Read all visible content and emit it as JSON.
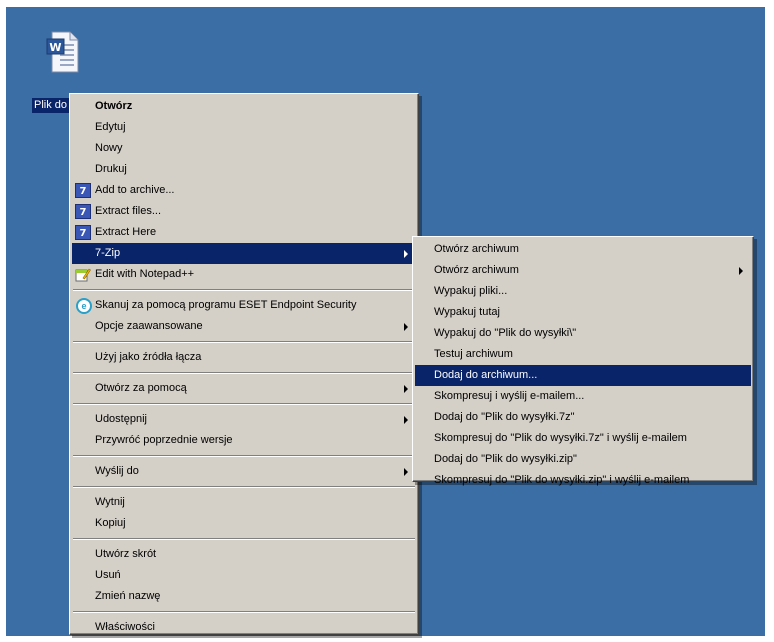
{
  "desktop": {
    "file_label": "Plik do wysyłki",
    "colors": {
      "background": "#3a6ea5",
      "selection": "#0a246a",
      "menu": "#d4d0c8"
    }
  },
  "context_menu": {
    "items": [
      {
        "label": "Otwórz"
      },
      {
        "label": "Edytuj"
      },
      {
        "label": "Nowy"
      },
      {
        "label": "Drukuj"
      },
      {
        "label": "Add to archive...",
        "icon": "7zip-icon"
      },
      {
        "label": "Extract files...",
        "icon": "7zip-icon"
      },
      {
        "label": "Extract Here",
        "icon": "7zip-icon"
      },
      {
        "label": "7-Zip"
      },
      {
        "label": "Edit with Notepad++",
        "icon": "notepad-plus-plus-icon"
      },
      {
        "label": "Skanuj za pomocą programu ESET Endpoint Security",
        "icon": "eset-icon"
      },
      {
        "label": "Opcje zaawansowane"
      },
      {
        "label": "Użyj jako źródła łącza"
      },
      {
        "label": "Otwórz za pomocą"
      },
      {
        "label": "Udostępnij"
      },
      {
        "label": "Przywróć poprzednie wersje"
      },
      {
        "label": "Wyślij do"
      },
      {
        "label": "Wytnij"
      },
      {
        "label": "Kopiuj"
      },
      {
        "label": "Utwórz skrót"
      },
      {
        "label": "Usuń"
      },
      {
        "label": "Zmień nazwę"
      },
      {
        "label": "Właściwości"
      }
    ]
  },
  "submenu_7zip": {
    "items": [
      {
        "label": "Otwórz archiwum"
      },
      {
        "label": "Otwórz archiwum"
      },
      {
        "label": "Wypakuj pliki..."
      },
      {
        "label": "Wypakuj tutaj"
      },
      {
        "label": "Wypakuj do \"Plik do wysyłki\\\""
      },
      {
        "label": "Testuj archiwum"
      },
      {
        "label": "Dodaj do archiwum..."
      },
      {
        "label": "Skompresuj i wyślij e-mailem..."
      },
      {
        "label": "Dodaj do \"Plik do wysyłki.7z\""
      },
      {
        "label": "Skompresuj do \"Plik do wysyłki.7z\" i wyślij e-mailem"
      },
      {
        "label": "Dodaj do \"Plik do wysyłki.zip\""
      },
      {
        "label": "Skompresuj do \"Plik do wysyłki.zip\" i wyślij e-mailem"
      }
    ]
  }
}
